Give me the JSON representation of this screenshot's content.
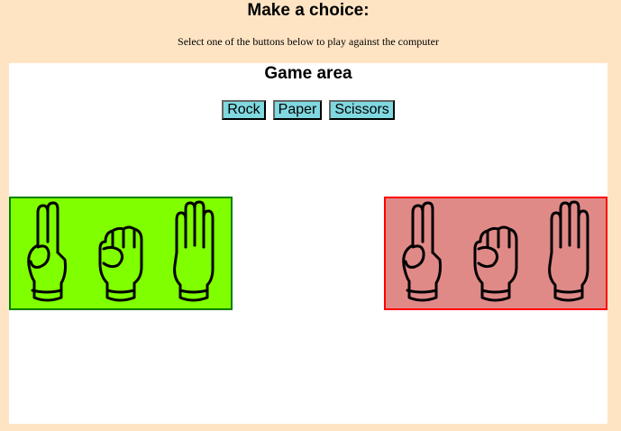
{
  "header": {
    "title": "Make a choice:",
    "subtitle": "Select one of the buttons below to play against the computer"
  },
  "game": {
    "title": "Game area",
    "buttons": [
      {
        "label": "Rock"
      },
      {
        "label": "Paper"
      },
      {
        "label": "Scissors"
      }
    ],
    "player_panel": {
      "color": "#80ff00",
      "border": "#008000",
      "icons": [
        "scissors-hand-icon",
        "rock-fist-icon",
        "paper-open-hand-icon"
      ]
    },
    "computer_panel": {
      "color": "#e08a88",
      "border": "#ff0000",
      "icons": [
        "scissors-hand-icon",
        "rock-fist-icon",
        "paper-open-hand-icon"
      ]
    }
  },
  "colors": {
    "page_background": "#ffe4c4",
    "button_background": "#80d8e0"
  }
}
